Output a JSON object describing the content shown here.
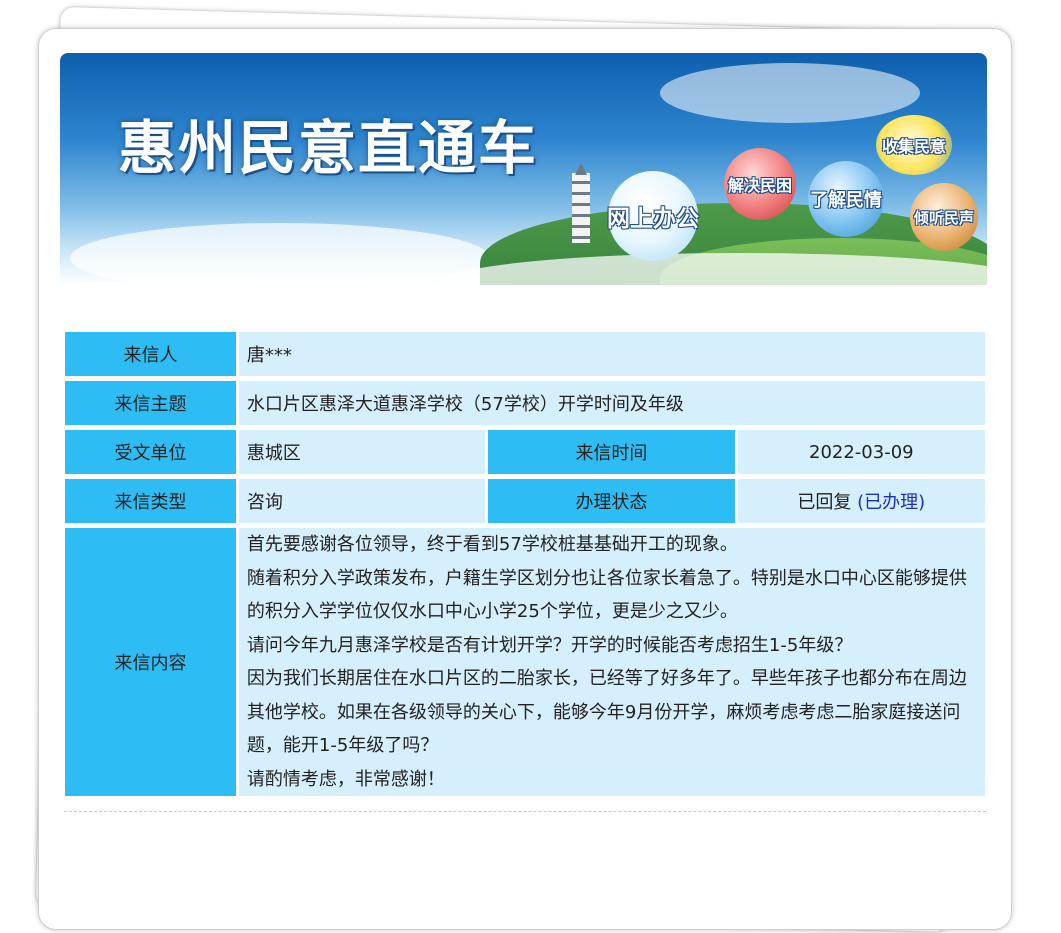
{
  "banner": {
    "title": "惠州民意直通车",
    "bubbles": {
      "online": "网上办公",
      "solve": "解决民困",
      "know": "了解民情",
      "collect": "收集民意",
      "listen": "倾听民声"
    }
  },
  "letter": {
    "sender_label": "来信人",
    "sender": "唐***",
    "subject_label": "来信主题",
    "subject": "水口片区惠泽大道惠泽学校（57学校）开学时间及年级",
    "unit_label": "受文单位",
    "unit": "惠城区",
    "time_label": "来信时间",
    "time": "2022-03-09",
    "type_label": "来信类型",
    "type": "咨询",
    "status_label": "办理状态",
    "status": "已回复",
    "status_link": "(已办理)",
    "content_label": "来信内容",
    "content": [
      "首先要感谢各位领导，终于看到57学校桩基基础开工的现象。",
      "随着积分入学政策发布，户籍生学区划分也让各位家长着急了。特别是水口中心区能够提供的积分入学学位仅仅水口中心小学25个学位，更是少之又少。",
      "请问今年九月惠泽学校是否有计划开学？开学的时候能否考虑招生1-5年级？",
      "因为我们长期居住在水口片区的二胎家长，已经等了好多年了。早些年孩子也都分布在周边其他学校。如果在各级领导的关心下，能够今年9月份开学，麻烦考虑考虑二胎家庭接送问题，能开1-5年级了吗？",
      "请酌情考虑，非常感谢！"
    ]
  }
}
